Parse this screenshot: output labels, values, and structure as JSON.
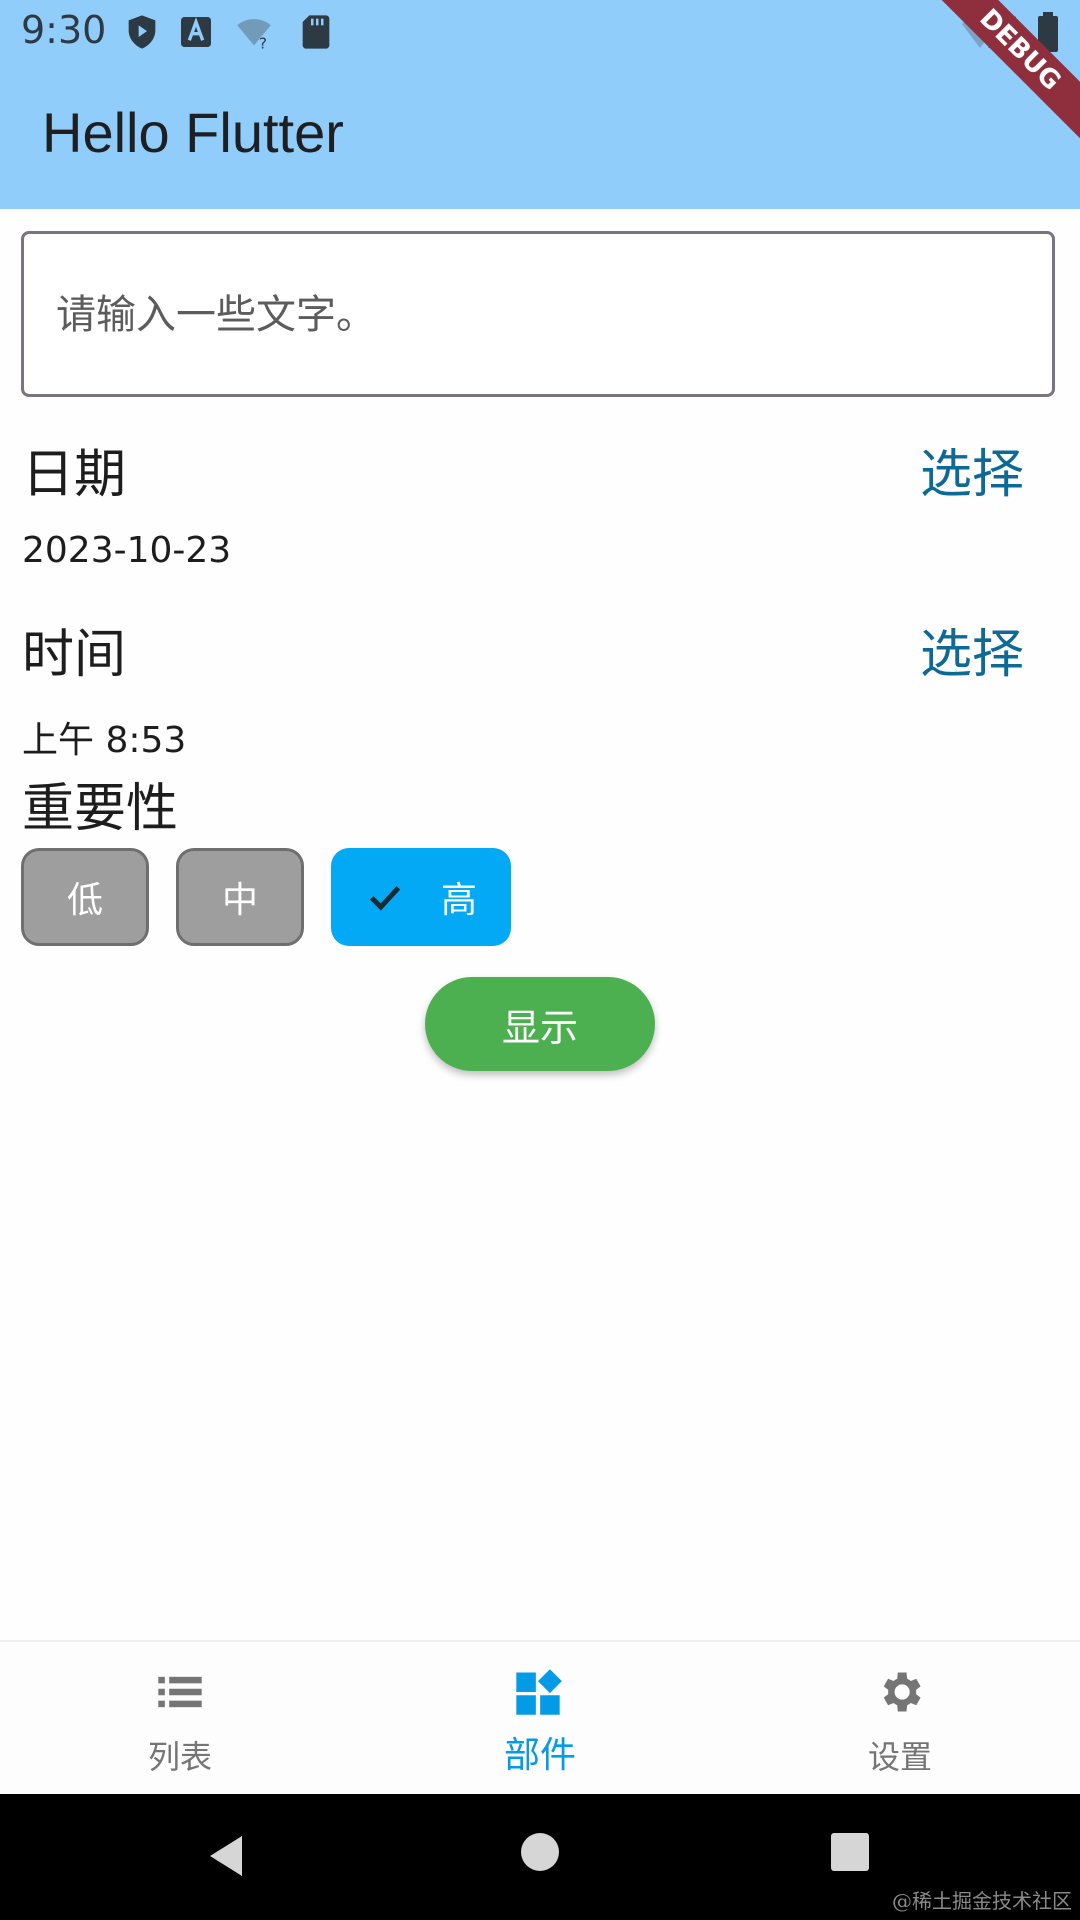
{
  "status_bar": {
    "time": "9:30"
  },
  "app_bar": {
    "title": "Hello Flutter",
    "debug_banner": "DEBUG"
  },
  "text_input": {
    "placeholder": "请输入一些文字。",
    "value": ""
  },
  "date_section": {
    "label": "日期",
    "select_label": "选择",
    "value": "2023-10-23"
  },
  "time_section": {
    "label": "时间",
    "select_label": "选择",
    "value": "上午 8:53"
  },
  "importance": {
    "label": "重要性",
    "options": [
      {
        "label": "低",
        "selected": false
      },
      {
        "label": "中",
        "selected": false
      },
      {
        "label": "高",
        "selected": true
      }
    ]
  },
  "show_button": {
    "label": "显示"
  },
  "bottom_nav": {
    "items": [
      {
        "label": "列表",
        "icon": "list-icon",
        "active": false
      },
      {
        "label": "部件",
        "icon": "widgets-icon",
        "active": true
      },
      {
        "label": "设置",
        "icon": "gear-icon",
        "active": false
      }
    ]
  },
  "watermark": "@稀土掘金技术社区",
  "colors": {
    "app_bar": "#90cdfb",
    "accent": "#03a9f4",
    "select_text": "#0d6a96",
    "chip_unselected": "#9e9e9e",
    "show_button": "#4caf50",
    "debug_ribbon": "#8f2f3d"
  }
}
